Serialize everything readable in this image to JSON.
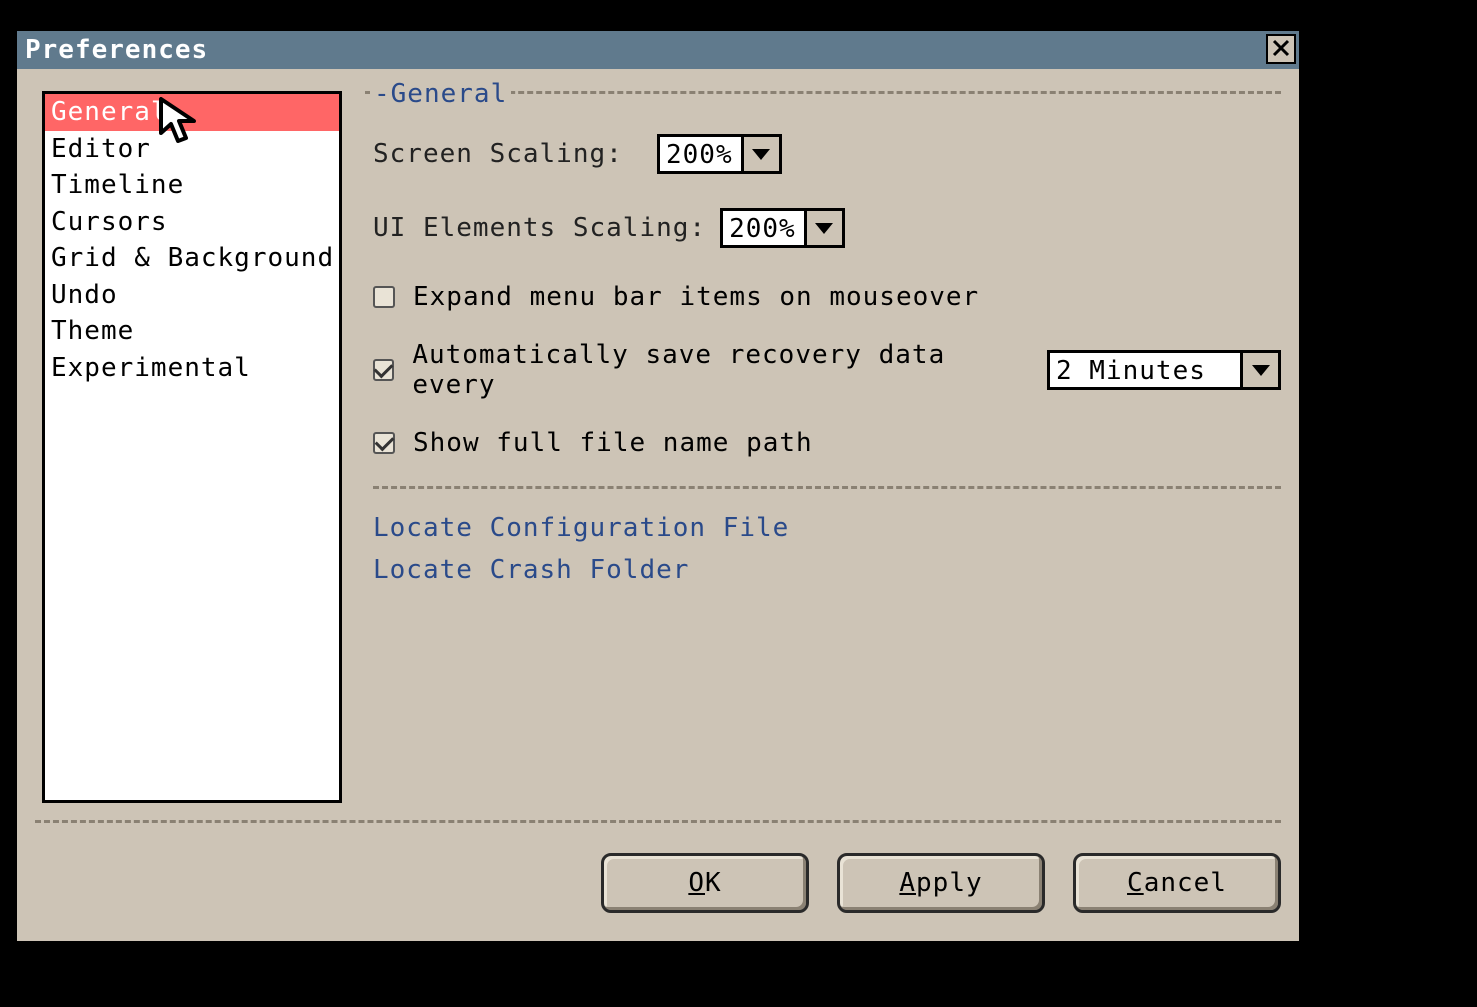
{
  "window": {
    "title": "Preferences"
  },
  "sidebar": {
    "items": [
      "General",
      "Editor",
      "Timeline",
      "Cursors",
      "Grid & Background",
      "Undo",
      "Theme",
      "Experimental"
    ],
    "selected": "General"
  },
  "panel": {
    "legend": "General",
    "screen_scaling": {
      "label": "Screen Scaling:",
      "value": "200%"
    },
    "ui_scaling": {
      "label": "UI Elements Scaling:",
      "value": "200%"
    },
    "expand_menu": {
      "checked": false,
      "label": "Expand menu bar items on mouseover"
    },
    "autosave": {
      "checked": true,
      "label": "Automatically save recovery data every",
      "value": "2 Minutes"
    },
    "show_path": {
      "checked": true,
      "label": "Show full file name path"
    },
    "links": {
      "config": "Locate Configuration File",
      "crash": "Locate Crash Folder"
    }
  },
  "buttons": {
    "ok": "OK",
    "apply": "Apply",
    "cancel": "Cancel"
  }
}
